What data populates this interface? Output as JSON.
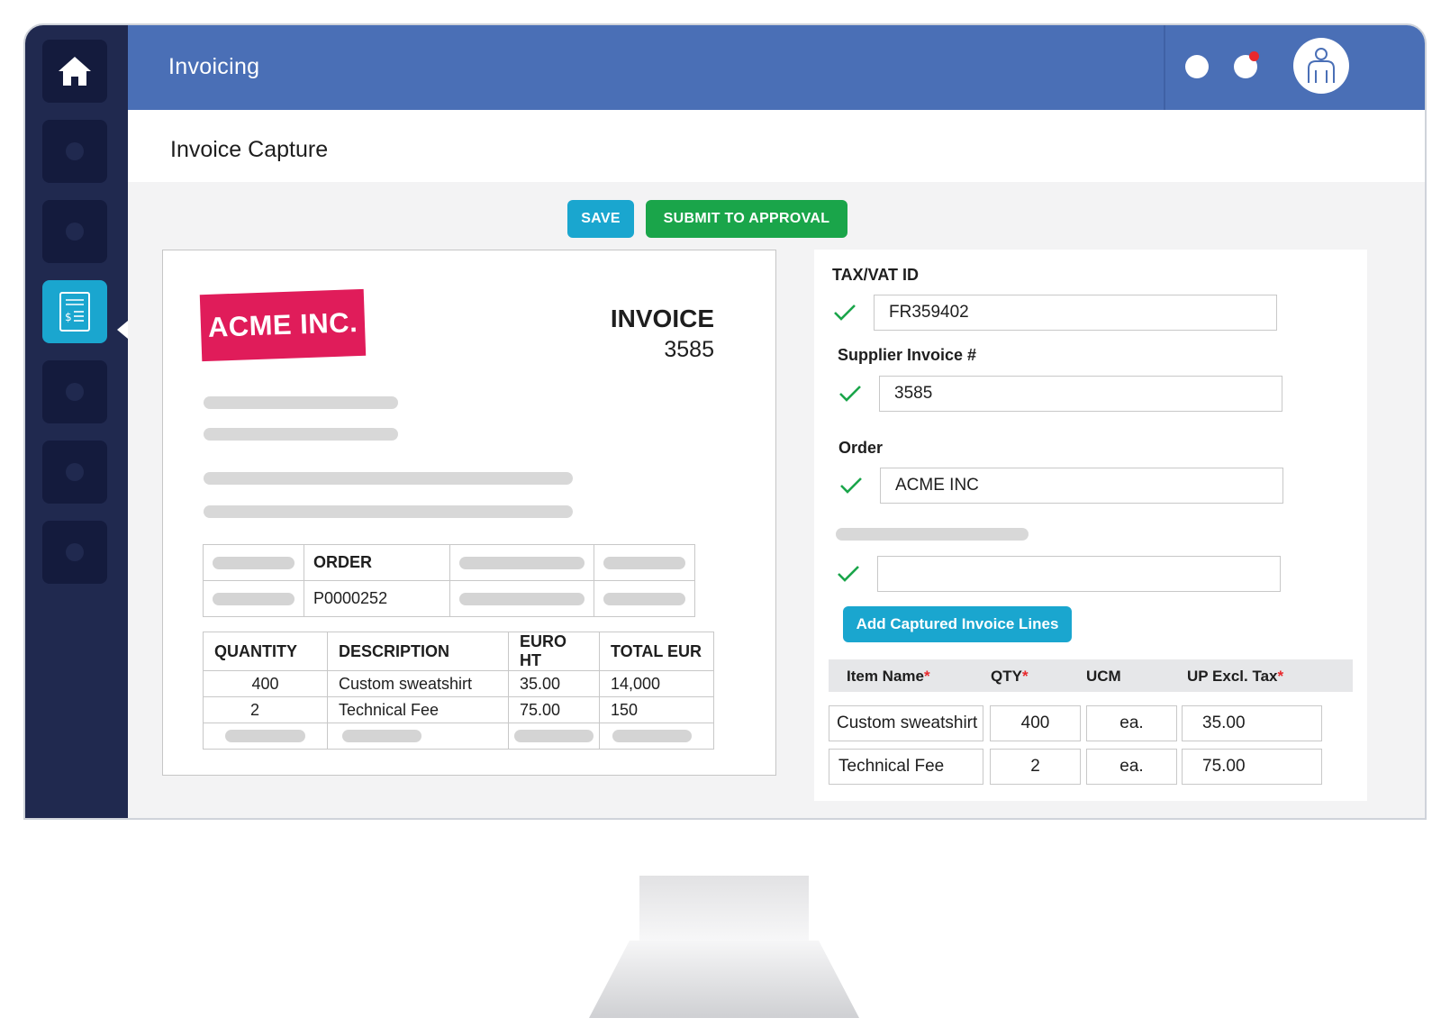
{
  "header": {
    "app_title": "Invoicing"
  },
  "page": {
    "title": "Invoice Capture"
  },
  "sidebar": {
    "items": [
      {
        "icon": "home-icon",
        "active": false
      },
      {
        "icon": "placeholder-icon",
        "active": false
      },
      {
        "icon": "placeholder-icon",
        "active": false
      },
      {
        "icon": "invoice-icon",
        "active": true
      },
      {
        "icon": "placeholder-icon",
        "active": false
      },
      {
        "icon": "placeholder-icon",
        "active": false
      },
      {
        "icon": "placeholder-icon",
        "active": false
      }
    ]
  },
  "toolbar": {
    "save_label": "SAVE",
    "submit_label": "SUBMIT TO APPROVAL"
  },
  "invoice": {
    "company": "ACME INC.",
    "title": "INVOICE",
    "number": "3585",
    "order_header": "ORDER",
    "order_value": "P0000252",
    "columns": [
      "QUANTITY",
      "DESCRIPTION",
      "EURO HT",
      "TOTAL EUR"
    ],
    "lines": [
      {
        "quantity": "400",
        "description": "Custom sweatshirt",
        "euro_ht": "35.00",
        "total_eur": "14,000"
      },
      {
        "quantity": "2",
        "description": "Technical Fee",
        "euro_ht": "75.00",
        "total_eur": "150"
      }
    ]
  },
  "form": {
    "tax_label": "TAX/VAT ID",
    "tax_value": "FR359402",
    "supplier_label": "Supplier Invoice #",
    "supplier_value": "3585",
    "order_label": "Order",
    "order_value": "ACME INC",
    "add_lines_label": "Add Captured Invoice Lines",
    "grid_columns": {
      "item_name": "Item Name",
      "qty": "QTY",
      "ucm": "UCM",
      "up_excl_tax": "UP Excl. Tax",
      "required_mark": "*"
    },
    "grid_rows": [
      {
        "item_name": "Custom sweatshirt",
        "qty": "400",
        "ucm": "ea.",
        "up": "35.00"
      },
      {
        "item_name": "Technical Fee",
        "qty": "2",
        "ucm": "ea.",
        "up": "75.00"
      }
    ]
  },
  "colors": {
    "sidebar": "#20294f",
    "header": "#4a6fb6",
    "accent_blue": "#1aa6cf",
    "accent_green": "#1aa54a",
    "brand_pink": "#e01c5a",
    "check_green": "#1aa54a",
    "required_red": "#e8282c"
  }
}
